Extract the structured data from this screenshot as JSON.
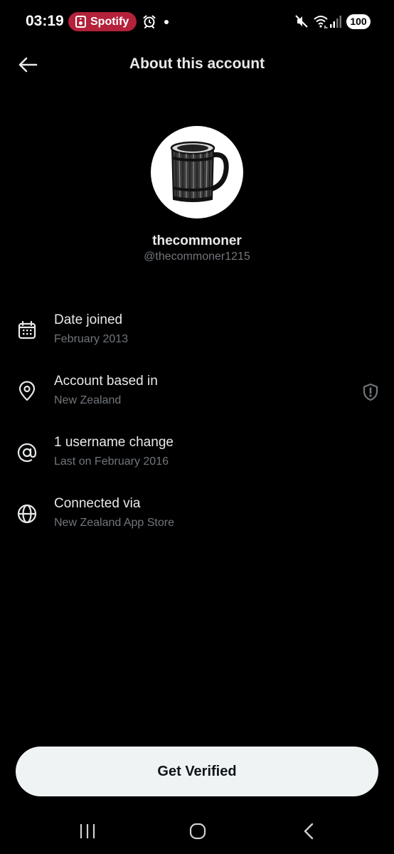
{
  "status_bar": {
    "time": "03:19",
    "notification_app": "Spotify",
    "battery": "100",
    "icons": [
      "spotify-icon",
      "alarm-icon",
      "mute-icon",
      "wifi-icon",
      "signal-icon"
    ]
  },
  "header": {
    "title": "About this account",
    "back_icon": "arrow-left-icon"
  },
  "profile": {
    "display_name": "thecommoner",
    "handle": "@thecommoner1215",
    "avatar": "wooden-tankard-illustration"
  },
  "info_rows": [
    {
      "icon": "calendar-icon",
      "title": "Date joined",
      "subtitle": "February 2013"
    },
    {
      "icon": "location-pin-icon",
      "title": "Account based in",
      "subtitle": "New Zealand",
      "trailing_icon": "shield-alert-icon"
    },
    {
      "icon": "at-sign-icon",
      "title": "1 username change",
      "subtitle": "Last on February 2016"
    },
    {
      "icon": "globe-icon",
      "title": "Connected via",
      "subtitle": "New Zealand App Store"
    }
  ],
  "actions": {
    "get_verified": "Get Verified"
  },
  "nav_bar": {
    "icons": [
      "recents-icon",
      "home-icon",
      "back-icon"
    ]
  },
  "colors": {
    "background": "#000000",
    "primary_text": "#e7e9ea",
    "secondary_text": "#71767b",
    "spotify_pill": "#b3213a",
    "button_bg": "#eff3f4"
  }
}
